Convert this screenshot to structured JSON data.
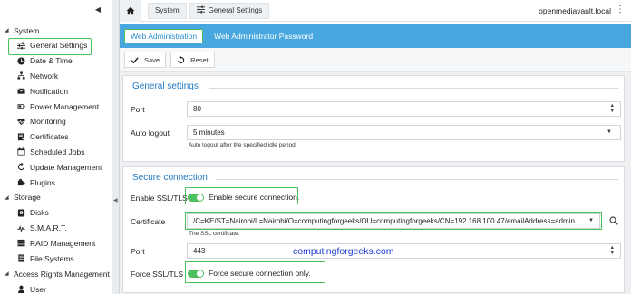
{
  "sidebar": {
    "collapse_icon": "chevron-left-icon",
    "sections": [
      {
        "label": "System",
        "items": [
          {
            "label": "General Settings",
            "icon": "sliders-icon",
            "active": true
          },
          {
            "label": "Date & Time",
            "icon": "clock-icon"
          },
          {
            "label": "Network",
            "icon": "network-icon"
          },
          {
            "label": "Notification",
            "icon": "envelope-icon"
          },
          {
            "label": "Power Management",
            "icon": "power-icon"
          },
          {
            "label": "Monitoring",
            "icon": "heartbeat-icon"
          },
          {
            "label": "Certificates",
            "icon": "certificate-icon"
          },
          {
            "label": "Scheduled Jobs",
            "icon": "calendar-icon"
          },
          {
            "label": "Update Management",
            "icon": "refresh-icon"
          },
          {
            "label": "Plugins",
            "icon": "puzzle-icon"
          }
        ]
      },
      {
        "label": "Storage",
        "items": [
          {
            "label": "Disks",
            "icon": "disk-icon"
          },
          {
            "label": "S.M.A.R.T.",
            "icon": "smart-icon"
          },
          {
            "label": "RAID Management",
            "icon": "raid-icon"
          },
          {
            "label": "File Systems",
            "icon": "folder-icon"
          }
        ]
      },
      {
        "label": "Access Rights Management",
        "items": [
          {
            "label": "User",
            "icon": "user-icon"
          }
        ]
      }
    ]
  },
  "topbar": {
    "breadcrumbs": [
      "System",
      "General Settings"
    ],
    "hostname": "openmediavault.local"
  },
  "tabs": [
    {
      "label": "Web Administration",
      "active": true
    },
    {
      "label": "Web Administrator Password",
      "active": false
    }
  ],
  "toolbar": {
    "save_label": "Save",
    "reset_label": "Reset"
  },
  "general": {
    "legend": "General settings",
    "port_label": "Port",
    "port_value": "80",
    "autologout_label": "Auto logout",
    "autologout_value": "5 minutes",
    "autologout_hint": "Auto logout after the specified idle period."
  },
  "secure": {
    "legend": "Secure connection",
    "enable_label": "Enable SSL/TLS",
    "enable_text": "Enable secure connection.",
    "enable_on": true,
    "cert_label": "Certificate",
    "cert_value": "/C=KE/ST=Nairobi/L=Nairobi/O=computingforgeeks/OU=computingforgeeks/CN=192.168.100.47/emailAddress=admin",
    "cert_hint": "The SSL certificate.",
    "port_label": "Port",
    "port_value": "443",
    "force_label": "Force SSL/TLS",
    "force_text": "Force secure connection only.",
    "force_on": true
  },
  "watermark": "computingforgeeks.com",
  "colors": {
    "accent": "#47a7de",
    "highlight": "#48c15a",
    "toggle": "#4cc05e",
    "legend": "#1e78c3"
  }
}
